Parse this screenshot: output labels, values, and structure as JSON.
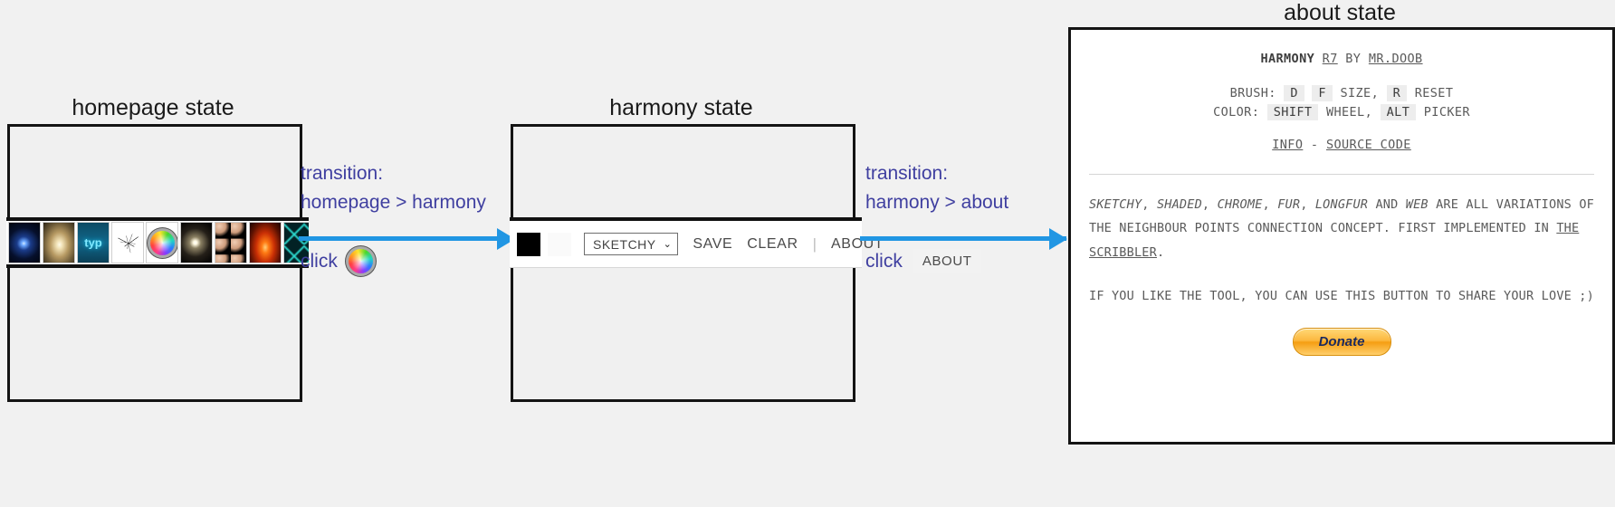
{
  "states": {
    "homepage": {
      "title": "homepage state",
      "thumbnails": [
        {
          "name": "thumb-blue-glow",
          "kind": "t-glow-blue",
          "label": ""
        },
        {
          "name": "thumb-gold-fractal",
          "kind": "t-gold",
          "label": ""
        },
        {
          "name": "thumb-typ",
          "kind": "t-typ",
          "label": "typ"
        },
        {
          "name": "thumb-wireframe",
          "kind": "t-wire",
          "label": ""
        },
        {
          "name": "thumb-harmony-colorwheel",
          "kind": "t-wheel",
          "label": ""
        },
        {
          "name": "thumb-white-glow",
          "kind": "t-glow-white",
          "label": ""
        },
        {
          "name": "thumb-spheres",
          "kind": "t-spheres",
          "label": ""
        },
        {
          "name": "thumb-fire",
          "kind": "t-fire",
          "label": ""
        },
        {
          "name": "thumb-teal-pattern",
          "kind": "t-teal",
          "label": ""
        }
      ]
    },
    "harmony": {
      "title": "harmony state",
      "toolbar": {
        "color_swatch": "black",
        "secondary_swatch": "white",
        "brush_value": "SKETCHY",
        "brush_caret": "⌄",
        "save_label": "SAVE",
        "clear_label": "CLEAR",
        "separator": "|",
        "about_label": "ABOUT"
      }
    },
    "about": {
      "title": "about state",
      "header": {
        "app_name": "HARMONY",
        "version": "R7",
        "by": "BY",
        "author": "MR.DOOB"
      },
      "shortcuts": {
        "brush_label": "BRUSH:",
        "brush_key_d": "D",
        "brush_key_f": "F",
        "brush_text": "SIZE,",
        "brush_key_r": "R",
        "brush_reset": "RESET",
        "color_label": "COLOR:",
        "color_key_shift": "SHIFT",
        "color_wheel": "WHEEL,",
        "color_key_alt": "ALT",
        "color_picker": "PICKER"
      },
      "links": {
        "info": "INFO",
        "dash": "-",
        "source_code": "SOURCE CODE"
      },
      "paragraph1": {
        "brush_sketchy": "SKETCHY",
        "sep1": ", ",
        "brush_shaded": "SHADED",
        "sep2": ", ",
        "brush_chrome": "CHROME",
        "sep3": ", ",
        "brush_fur": "FUR",
        "sep4": ", ",
        "brush_longfur": "LONGFUR",
        "and": " AND ",
        "brush_web": "WEB",
        "tail": " ARE ALL VARIATIONS OF THE NEIGHBOUR POINTS CONNECTION CONCEPT. FIRST IMPLEMENTED IN ",
        "scribbler": "THE SCRIBBLER",
        "period": "."
      },
      "paragraph2": "IF YOU LIKE THE TOOL, YOU CAN USE THIS BUTTON TO SHARE YOUR LOVE ;)",
      "donate_label": "Donate"
    }
  },
  "transitions": [
    {
      "name": "homepage-to-harmony",
      "line1": "transition:",
      "line2": "homepage > harmony",
      "click_label": "click",
      "click_target_kind": "color-wheel-icon",
      "click_target_text": ""
    },
    {
      "name": "harmony-to-about",
      "line1": "transition:",
      "line2": "harmony > about",
      "click_label": "click",
      "click_target_kind": "about-chip",
      "click_target_text": "ABOUT"
    }
  ],
  "colors": {
    "arrow": "#2196e3",
    "transition_text": "#3f3fa0",
    "frame_border": "#141414",
    "background": "#f1f1f1",
    "donate_orange": "#fcb83f"
  }
}
